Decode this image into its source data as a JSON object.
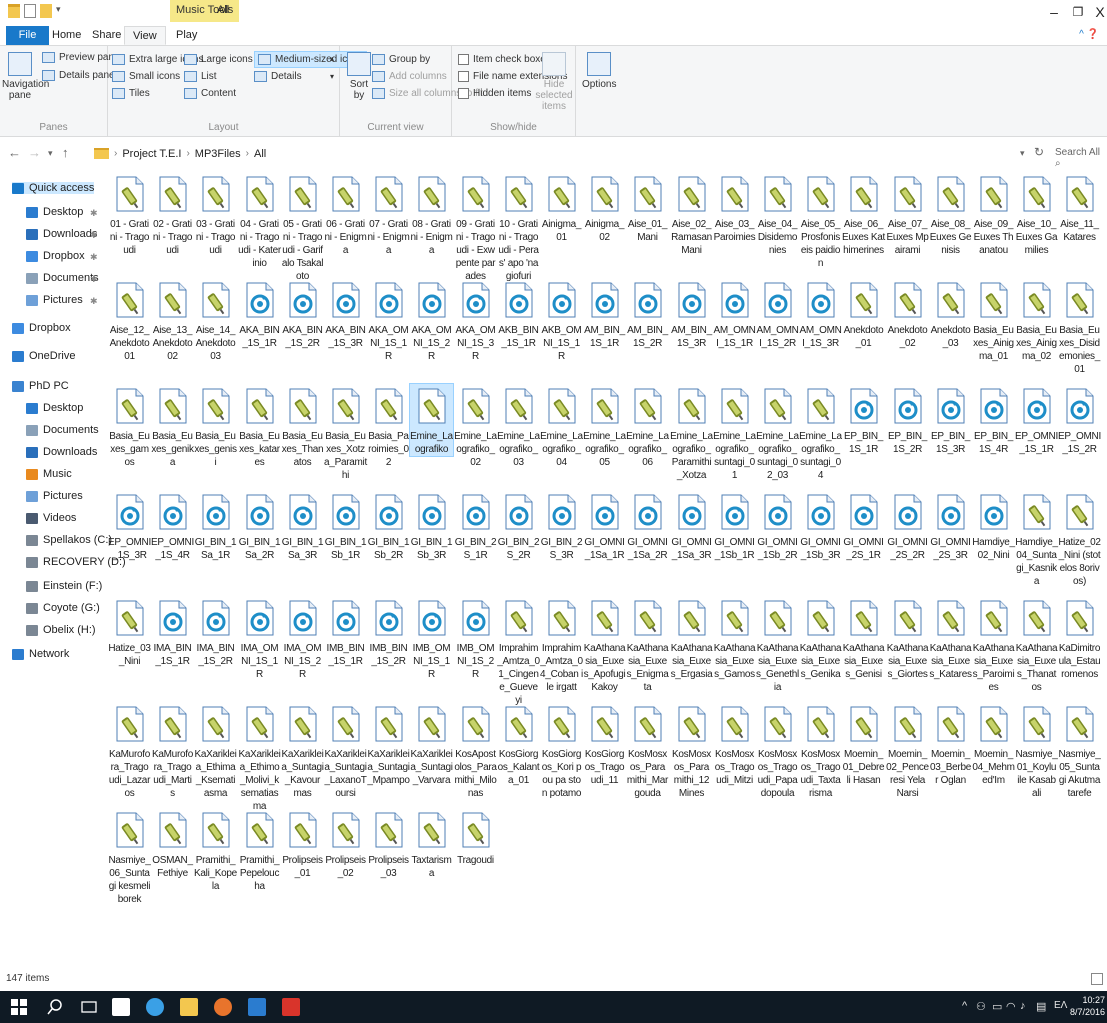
{
  "window": {
    "context_tab": "Music Tools",
    "title": "All",
    "minimize": "–",
    "maximize": "❐",
    "close": "X"
  },
  "ribbon_tabs": [
    "File",
    "Home",
    "Share",
    "View",
    "Play"
  ],
  "ribbon": {
    "panes": {
      "navigation_pane": "Navigation pane",
      "preview_pane": "Preview pane",
      "details_pane": "Details pane",
      "label": "Panes"
    },
    "layout": {
      "extra_large_icons": "Extra large icons",
      "large_icons": "Large icons",
      "medium_icons": "Medium-sized icons",
      "small_icons": "Small icons",
      "list": "List",
      "details": "Details",
      "tiles": "Tiles",
      "content": "Content",
      "label": "Layout"
    },
    "current_view": {
      "sort_by": "Sort by",
      "group_by": "Group by",
      "add_columns": "Add columns",
      "size_all_columns": "Size all columns to fit",
      "label": "Current view"
    },
    "show_hide": {
      "item_check_boxes": "Item check boxes",
      "file_name_extensions": "File name extensions",
      "hidden_items": "Hidden items",
      "hide_selected_items": "Hide selected items",
      "label": "Show/hide"
    },
    "options": "Options"
  },
  "address": {
    "breadcrumbs": [
      "Project T.E.I",
      "MP3Files",
      "All"
    ],
    "search_placeholder": "Search All"
  },
  "nav_pane": [
    {
      "label": "Quick access",
      "icon": "star-icon",
      "pinned": false
    },
    {
      "label": "Desktop",
      "icon": "desktop-icon",
      "pinned": true
    },
    {
      "label": "Downloads",
      "icon": "download-icon",
      "pinned": true
    },
    {
      "label": "Dropbox",
      "icon": "dropbox-icon",
      "pinned": true
    },
    {
      "label": "Documents",
      "icon": "documents-icon",
      "pinned": true
    },
    {
      "label": "Pictures",
      "icon": "pictures-icon",
      "pinned": true
    },
    {
      "label": "Dropbox",
      "icon": "dropbox-icon",
      "pinned": false
    },
    {
      "label": "OneDrive",
      "icon": "onedrive-icon",
      "pinned": false
    },
    {
      "label": "PhD PC",
      "icon": "pc-icon",
      "pinned": false
    },
    {
      "label": "Desktop",
      "icon": "desktop-icon",
      "pinned": false
    },
    {
      "label": "Documents",
      "icon": "documents-icon",
      "pinned": false
    },
    {
      "label": "Downloads",
      "icon": "download-icon",
      "pinned": false
    },
    {
      "label": "Music",
      "icon": "music-icon",
      "pinned": false
    },
    {
      "label": "Pictures",
      "icon": "pictures-icon",
      "pinned": false
    },
    {
      "label": "Videos",
      "icon": "videos-icon",
      "pinned": false
    },
    {
      "label": "Spellakos (C:)",
      "icon": "drive-icon",
      "pinned": false
    },
    {
      "label": "RECOVERY (D:)",
      "icon": "drive-icon",
      "pinned": false
    },
    {
      "label": "Einstein (F:)",
      "icon": "drive-icon",
      "pinned": false
    },
    {
      "label": "Coyote (G:)",
      "icon": "drive-icon",
      "pinned": false
    },
    {
      "label": "Obelix (H:)",
      "icon": "drive-icon",
      "pinned": false
    },
    {
      "label": "Network",
      "icon": "network-icon",
      "pinned": false
    }
  ],
  "files": [
    {
      "name": "01 - Gratini - Tragoudi",
      "icon": "audio-file-icon"
    },
    {
      "name": "02 - Gratini - Tragoudi",
      "icon": "audio-file-icon"
    },
    {
      "name": "03 - Gratini - Tragoudi",
      "icon": "audio-file-icon"
    },
    {
      "name": "04 - Gratini - Tragoudi - Katerinio",
      "icon": "audio-file-icon"
    },
    {
      "name": "05 - Gratini - Tragoudi - Garifalo Tsakaloto",
      "icon": "audio-file-icon"
    },
    {
      "name": "06 - Gratini - Enigma",
      "icon": "audio-file-icon"
    },
    {
      "name": "07 - Gratini - Enigma",
      "icon": "audio-file-icon"
    },
    {
      "name": "08 - Gratini - Enigma",
      "icon": "audio-file-icon"
    },
    {
      "name": "09 - Gratini - Tragoudi - Exw pente parades",
      "icon": "audio-file-icon"
    },
    {
      "name": "10 - Gratini - Tragoudi - Peras' apo 'na giofuri",
      "icon": "audio-file-icon"
    },
    {
      "name": "Ainigma_01",
      "icon": "audio-file-icon"
    },
    {
      "name": "Ainigma_02",
      "icon": "audio-file-icon"
    },
    {
      "name": "Aise_01_Mani",
      "icon": "audio-file-icon"
    },
    {
      "name": "Aise_02_Ramasan Mani",
      "icon": "audio-file-icon"
    },
    {
      "name": "Aise_03_Paroimies",
      "icon": "audio-file-icon"
    },
    {
      "name": "Aise_04_Disidemonies",
      "icon": "audio-file-icon"
    },
    {
      "name": "Aise_05_Prosfoniseis paidion",
      "icon": "audio-file-icon"
    },
    {
      "name": "Aise_06_Euxes Kathimerines",
      "icon": "audio-file-icon"
    },
    {
      "name": "Aise_07_Euxes Mpairami",
      "icon": "audio-file-icon"
    },
    {
      "name": "Aise_08_Euxes Genisis",
      "icon": "audio-file-icon"
    },
    {
      "name": "Aise_09_Euxes Thanatou",
      "icon": "audio-file-icon"
    },
    {
      "name": "Aise_10_Euxes Gamilies",
      "icon": "audio-file-icon"
    },
    {
      "name": "Aise_11_Katares",
      "icon": "audio-file-icon"
    },
    {
      "name": "Aise_12_Anekdoto 01",
      "icon": "audio-file-icon"
    },
    {
      "name": "Aise_13_Anekdoto 02",
      "icon": "audio-file-icon"
    },
    {
      "name": "Aise_14_Anekdoto 03",
      "icon": "audio-file-icon"
    },
    {
      "name": "AKA_BIN_1S_1R",
      "icon": "media-file-icon"
    },
    {
      "name": "AKA_BIN_1S_2R",
      "icon": "media-file-icon"
    },
    {
      "name": "AKA_BIN_1S_3R",
      "icon": "media-file-icon"
    },
    {
      "name": "AKA_OMNI_1S_1R",
      "icon": "media-file-icon"
    },
    {
      "name": "AKA_OMNI_1S_2R",
      "icon": "media-file-icon"
    },
    {
      "name": "AKA_OMNI_1S_3R",
      "icon": "media-file-icon"
    },
    {
      "name": "AKB_BIN_1S_1R",
      "icon": "media-file-icon"
    },
    {
      "name": "AKB_OMNI_1S_1R",
      "icon": "media-file-icon"
    },
    {
      "name": "AM_BIN_1S_1R",
      "icon": "media-file-icon"
    },
    {
      "name": "AM_BIN_1S_2R",
      "icon": "media-file-icon"
    },
    {
      "name": "AM_BIN_1S_3R",
      "icon": "media-file-icon"
    },
    {
      "name": "AM_OMNI_1S_1R",
      "icon": "media-file-icon"
    },
    {
      "name": "AM_OMNI_1S_2R",
      "icon": "media-file-icon"
    },
    {
      "name": "AM_OMNI_1S_3R",
      "icon": "media-file-icon"
    },
    {
      "name": "Anekdoto_01",
      "icon": "audio-file-icon"
    },
    {
      "name": "Anekdoto_02",
      "icon": "audio-file-icon"
    },
    {
      "name": "Anekdoto_03",
      "icon": "audio-file-icon"
    },
    {
      "name": "Basia_Euxes_Ainigma_01",
      "icon": "audio-file-icon"
    },
    {
      "name": "Basia_Euxes_Ainigma_02",
      "icon": "audio-file-icon"
    },
    {
      "name": "Basia_Euxes_Disidemonies_01",
      "icon": "audio-file-icon"
    },
    {
      "name": "Basia_Euxes_gamos",
      "icon": "audio-file-icon"
    },
    {
      "name": "Basia_Euxes_genika",
      "icon": "audio-file-icon"
    },
    {
      "name": "Basia_Euxes_genisi",
      "icon": "audio-file-icon"
    },
    {
      "name": "Basia_Euxes_katares",
      "icon": "audio-file-icon"
    },
    {
      "name": "Basia_Euxes_Thanatos",
      "icon": "audio-file-icon"
    },
    {
      "name": "Basia_Euxes_Xotza_Paramithi",
      "icon": "audio-file-icon"
    },
    {
      "name": "Basia_Paroimies_02",
      "icon": "audio-file-icon"
    },
    {
      "name": "Emine_Laografiko",
      "icon": "audio-file-icon",
      "selected": true
    },
    {
      "name": "Emine_Laografiko_02",
      "icon": "audio-file-icon"
    },
    {
      "name": "Emine_Laografiko_03",
      "icon": "audio-file-icon"
    },
    {
      "name": "Emine_Laografiko_04",
      "icon": "audio-file-icon"
    },
    {
      "name": "Emine_Laografiko_05",
      "icon": "audio-file-icon"
    },
    {
      "name": "Emine_Laografiko_06",
      "icon": "audio-file-icon"
    },
    {
      "name": "Emine_Laografiko_Paramithi_Xotza",
      "icon": "audio-file-icon"
    },
    {
      "name": "Emine_Laografiko_suntagi_01",
      "icon": "audio-file-icon"
    },
    {
      "name": "Emine_Laografiko_suntagi_02_03",
      "icon": "audio-file-icon"
    },
    {
      "name": "Emine_Laografiko_suntagi_04",
      "icon": "audio-file-icon"
    },
    {
      "name": "EP_BIN_1S_1R",
      "icon": "media-file-icon"
    },
    {
      "name": "EP_BIN_1S_2R",
      "icon": "media-file-icon"
    },
    {
      "name": "EP_BIN_1S_3R",
      "icon": "media-file-icon"
    },
    {
      "name": "EP_BIN_1S_4R",
      "icon": "media-file-icon"
    },
    {
      "name": "EP_OMNI_1S_1R",
      "icon": "media-file-icon"
    },
    {
      "name": "EP_OMNI_1S_2R",
      "icon": "media-file-icon"
    },
    {
      "name": "EP_OMNI_1S_3R",
      "icon": "media-file-icon"
    },
    {
      "name": "EP_OMNI_1S_4R",
      "icon": "media-file-icon"
    },
    {
      "name": "GI_BIN_1Sa_1R",
      "icon": "media-file-icon"
    },
    {
      "name": "GI_BIN_1Sa_2R",
      "icon": "media-file-icon"
    },
    {
      "name": "GI_BIN_1Sa_3R",
      "icon": "media-file-icon"
    },
    {
      "name": "GI_BIN_1Sb_1R",
      "icon": "media-file-icon"
    },
    {
      "name": "GI_BIN_1Sb_2R",
      "icon": "media-file-icon"
    },
    {
      "name": "GI_BIN_1Sb_3R",
      "icon": "media-file-icon"
    },
    {
      "name": "GI_BIN_2S_1R",
      "icon": "media-file-icon"
    },
    {
      "name": "GI_BIN_2S_2R",
      "icon": "media-file-icon"
    },
    {
      "name": "GI_BIN_2S_3R",
      "icon": "media-file-icon"
    },
    {
      "name": "GI_OMNI_1Sa_1R",
      "icon": "media-file-icon"
    },
    {
      "name": "GI_OMNI_1Sa_2R",
      "icon": "media-file-icon"
    },
    {
      "name": "GI_OMNI_1Sa_3R",
      "icon": "media-file-icon"
    },
    {
      "name": "GI_OMNI_1Sb_1R",
      "icon": "media-file-icon"
    },
    {
      "name": "GI_OMNI_1Sb_2R",
      "icon": "media-file-icon"
    },
    {
      "name": "GI_OMNI_1Sb_3R",
      "icon": "media-file-icon"
    },
    {
      "name": "GI_OMNI_2S_1R",
      "icon": "media-file-icon"
    },
    {
      "name": "GI_OMNI_2S_2R",
      "icon": "media-file-icon"
    },
    {
      "name": "GI_OMNI_2S_3R",
      "icon": "media-file-icon"
    },
    {
      "name": "Hamdiye_02_Nini",
      "icon": "media-file-icon"
    },
    {
      "name": "Hamdiye_04_Suntagi_Kasnika",
      "icon": "audio-file-icon"
    },
    {
      "name": "Hatize_02_Nini (stotelos 8orivos)",
      "icon": "audio-file-icon"
    },
    {
      "name": "Hatize_03_Nini",
      "icon": "audio-file-icon"
    },
    {
      "name": "IMA_BIN_1S_1R",
      "icon": "media-file-icon"
    },
    {
      "name": "IMA_BIN_1S_2R",
      "icon": "media-file-icon"
    },
    {
      "name": "IMA_OMNI_1S_1R",
      "icon": "media-file-icon"
    },
    {
      "name": "IMA_OMNI_1S_2R",
      "icon": "media-file-icon"
    },
    {
      "name": "IMB_BIN_1S_1R",
      "icon": "media-file-icon"
    },
    {
      "name": "IMB_BIN_1S_2R",
      "icon": "media-file-icon"
    },
    {
      "name": "IMB_OMNI_1S_1R",
      "icon": "media-file-icon"
    },
    {
      "name": "IMB_OMNI_1S_2R",
      "icon": "media-file-icon"
    },
    {
      "name": "Imprahim_Amtza_01_Cingene_Gueveyi",
      "icon": "audio-file-icon"
    },
    {
      "name": "Imprahim_Amtza_04_Coban ile irgatt",
      "icon": "audio-file-icon"
    },
    {
      "name": "KaAthanasia_Euxes_ApofugiKakoy",
      "icon": "audio-file-icon"
    },
    {
      "name": "KaAthanasia_Euxes_Enigmata",
      "icon": "audio-file-icon"
    },
    {
      "name": "KaAthanasia_Euxes_Ergasia",
      "icon": "audio-file-icon"
    },
    {
      "name": "KaAthanasia_Euxes_Gamos",
      "icon": "audio-file-icon"
    },
    {
      "name": "KaAthanasia_Euxes_Genethlia",
      "icon": "audio-file-icon"
    },
    {
      "name": "KaAthanasia_Euxes_Genika",
      "icon": "audio-file-icon"
    },
    {
      "name": "KaAthanasia_Euxes_Genisi",
      "icon": "audio-file-icon"
    },
    {
      "name": "KaAthanasia_Euxes_Giortes",
      "icon": "audio-file-icon"
    },
    {
      "name": "KaAthanasia_Euxes_Katares",
      "icon": "audio-file-icon"
    },
    {
      "name": "KaAthanasia_Euxes_Paroimies",
      "icon": "audio-file-icon"
    },
    {
      "name": "KaAthanasia_Euxes_Thanatos",
      "icon": "audio-file-icon"
    },
    {
      "name": "KaDimitroula_Estauromenos",
      "icon": "audio-file-icon"
    },
    {
      "name": "KaMurofora_Tragoudi_Lazaros",
      "icon": "audio-file-icon"
    },
    {
      "name": "KaMurofora_Tragoudi_Martis",
      "icon": "audio-file-icon"
    },
    {
      "name": "KaXarikleia_Ethima_Ksematiasma",
      "icon": "audio-file-icon"
    },
    {
      "name": "KaXarikleia_Ethimo_Molivi_ksematiasma",
      "icon": "audio-file-icon"
    },
    {
      "name": "KaXarikleia_Suntagi_Kavourmas",
      "icon": "audio-file-icon"
    },
    {
      "name": "KaXarikleia_Suntagi_LaxanoToursi",
      "icon": "audio-file-icon"
    },
    {
      "name": "KaXarikleia_Suntagi_Mpampo",
      "icon": "audio-file-icon"
    },
    {
      "name": "KaXarikleia_Suntagi_Varvara",
      "icon": "audio-file-icon"
    },
    {
      "name": "KosApostolos_Paramithi_Milonas",
      "icon": "audio-file-icon"
    },
    {
      "name": "KosGiorgos_Kalanta_01",
      "icon": "audio-file-icon"
    },
    {
      "name": "KosGiorgos_Kori pou pa ston potamo",
      "icon": "audio-file-icon"
    },
    {
      "name": "KosGiorgos_Tragoudi_11",
      "icon": "audio-file-icon"
    },
    {
      "name": "KosMosxos_Paramithi_Margouda",
      "icon": "audio-file-icon"
    },
    {
      "name": "KosMosxos_Paramithi_12Mines",
      "icon": "audio-file-icon"
    },
    {
      "name": "KosMosxos_Tragoudi_Mitzi",
      "icon": "audio-file-icon"
    },
    {
      "name": "KosMosxos_Tragoudi_Papadopoula",
      "icon": "audio-file-icon"
    },
    {
      "name": "KosMosxos_Tragoudi_Taxtarisma",
      "icon": "audio-file-icon"
    },
    {
      "name": "Moemin_01_Debreli Hasan",
      "icon": "audio-file-icon"
    },
    {
      "name": "Moemin_02_Penceresi Yela Narsi",
      "icon": "audio-file-icon"
    },
    {
      "name": "Moemin_03_Berber Oglan",
      "icon": "audio-file-icon"
    },
    {
      "name": "Moemin_04_Mehmed'Im",
      "icon": "audio-file-icon"
    },
    {
      "name": "Nasmiye_01_Koylu ile Kasabali",
      "icon": "audio-file-icon"
    },
    {
      "name": "Nasmiye_05_Suntagi Akutma tarefe",
      "icon": "audio-file-icon"
    },
    {
      "name": "Nasmiye_06_Suntagi kesmeli borek",
      "icon": "audio-file-icon"
    },
    {
      "name": "OSMAN_Fethiye",
      "icon": "audio-file-icon"
    },
    {
      "name": "Pramithi_Kali_Kopela",
      "icon": "audio-file-icon"
    },
    {
      "name": "Pramithi_Pepeloucha",
      "icon": "audio-file-icon"
    },
    {
      "name": "Prolipseis_01",
      "icon": "audio-file-icon"
    },
    {
      "name": "Prolipseis_02",
      "icon": "audio-file-icon"
    },
    {
      "name": "Prolipseis_03",
      "icon": "audio-file-icon"
    },
    {
      "name": "Taxtarisma",
      "icon": "audio-file-icon"
    },
    {
      "name": "Tragoudi",
      "icon": "audio-file-icon"
    }
  ],
  "status": {
    "item_count": "147 items"
  },
  "taskbar": {
    "apps": [
      "windows-start-icon",
      "search-icon",
      "task-view-icon",
      "store-icon",
      "hp-icon",
      "file-explorer-icon",
      "firefox-icon",
      "app-icon",
      "acrobat-icon"
    ],
    "tray_lang": "ΕΛ",
    "clock_time": "10:27",
    "clock_date": "8/7/2016"
  },
  "colors": {
    "accent": "#1979ca",
    "audio_icon_accent": "#7a8a24",
    "media_icon_accent": "#1e8ec8",
    "selection": "#cce8ff",
    "taskbar": "#0f1a24",
    "context_tab": "#f6e889"
  }
}
